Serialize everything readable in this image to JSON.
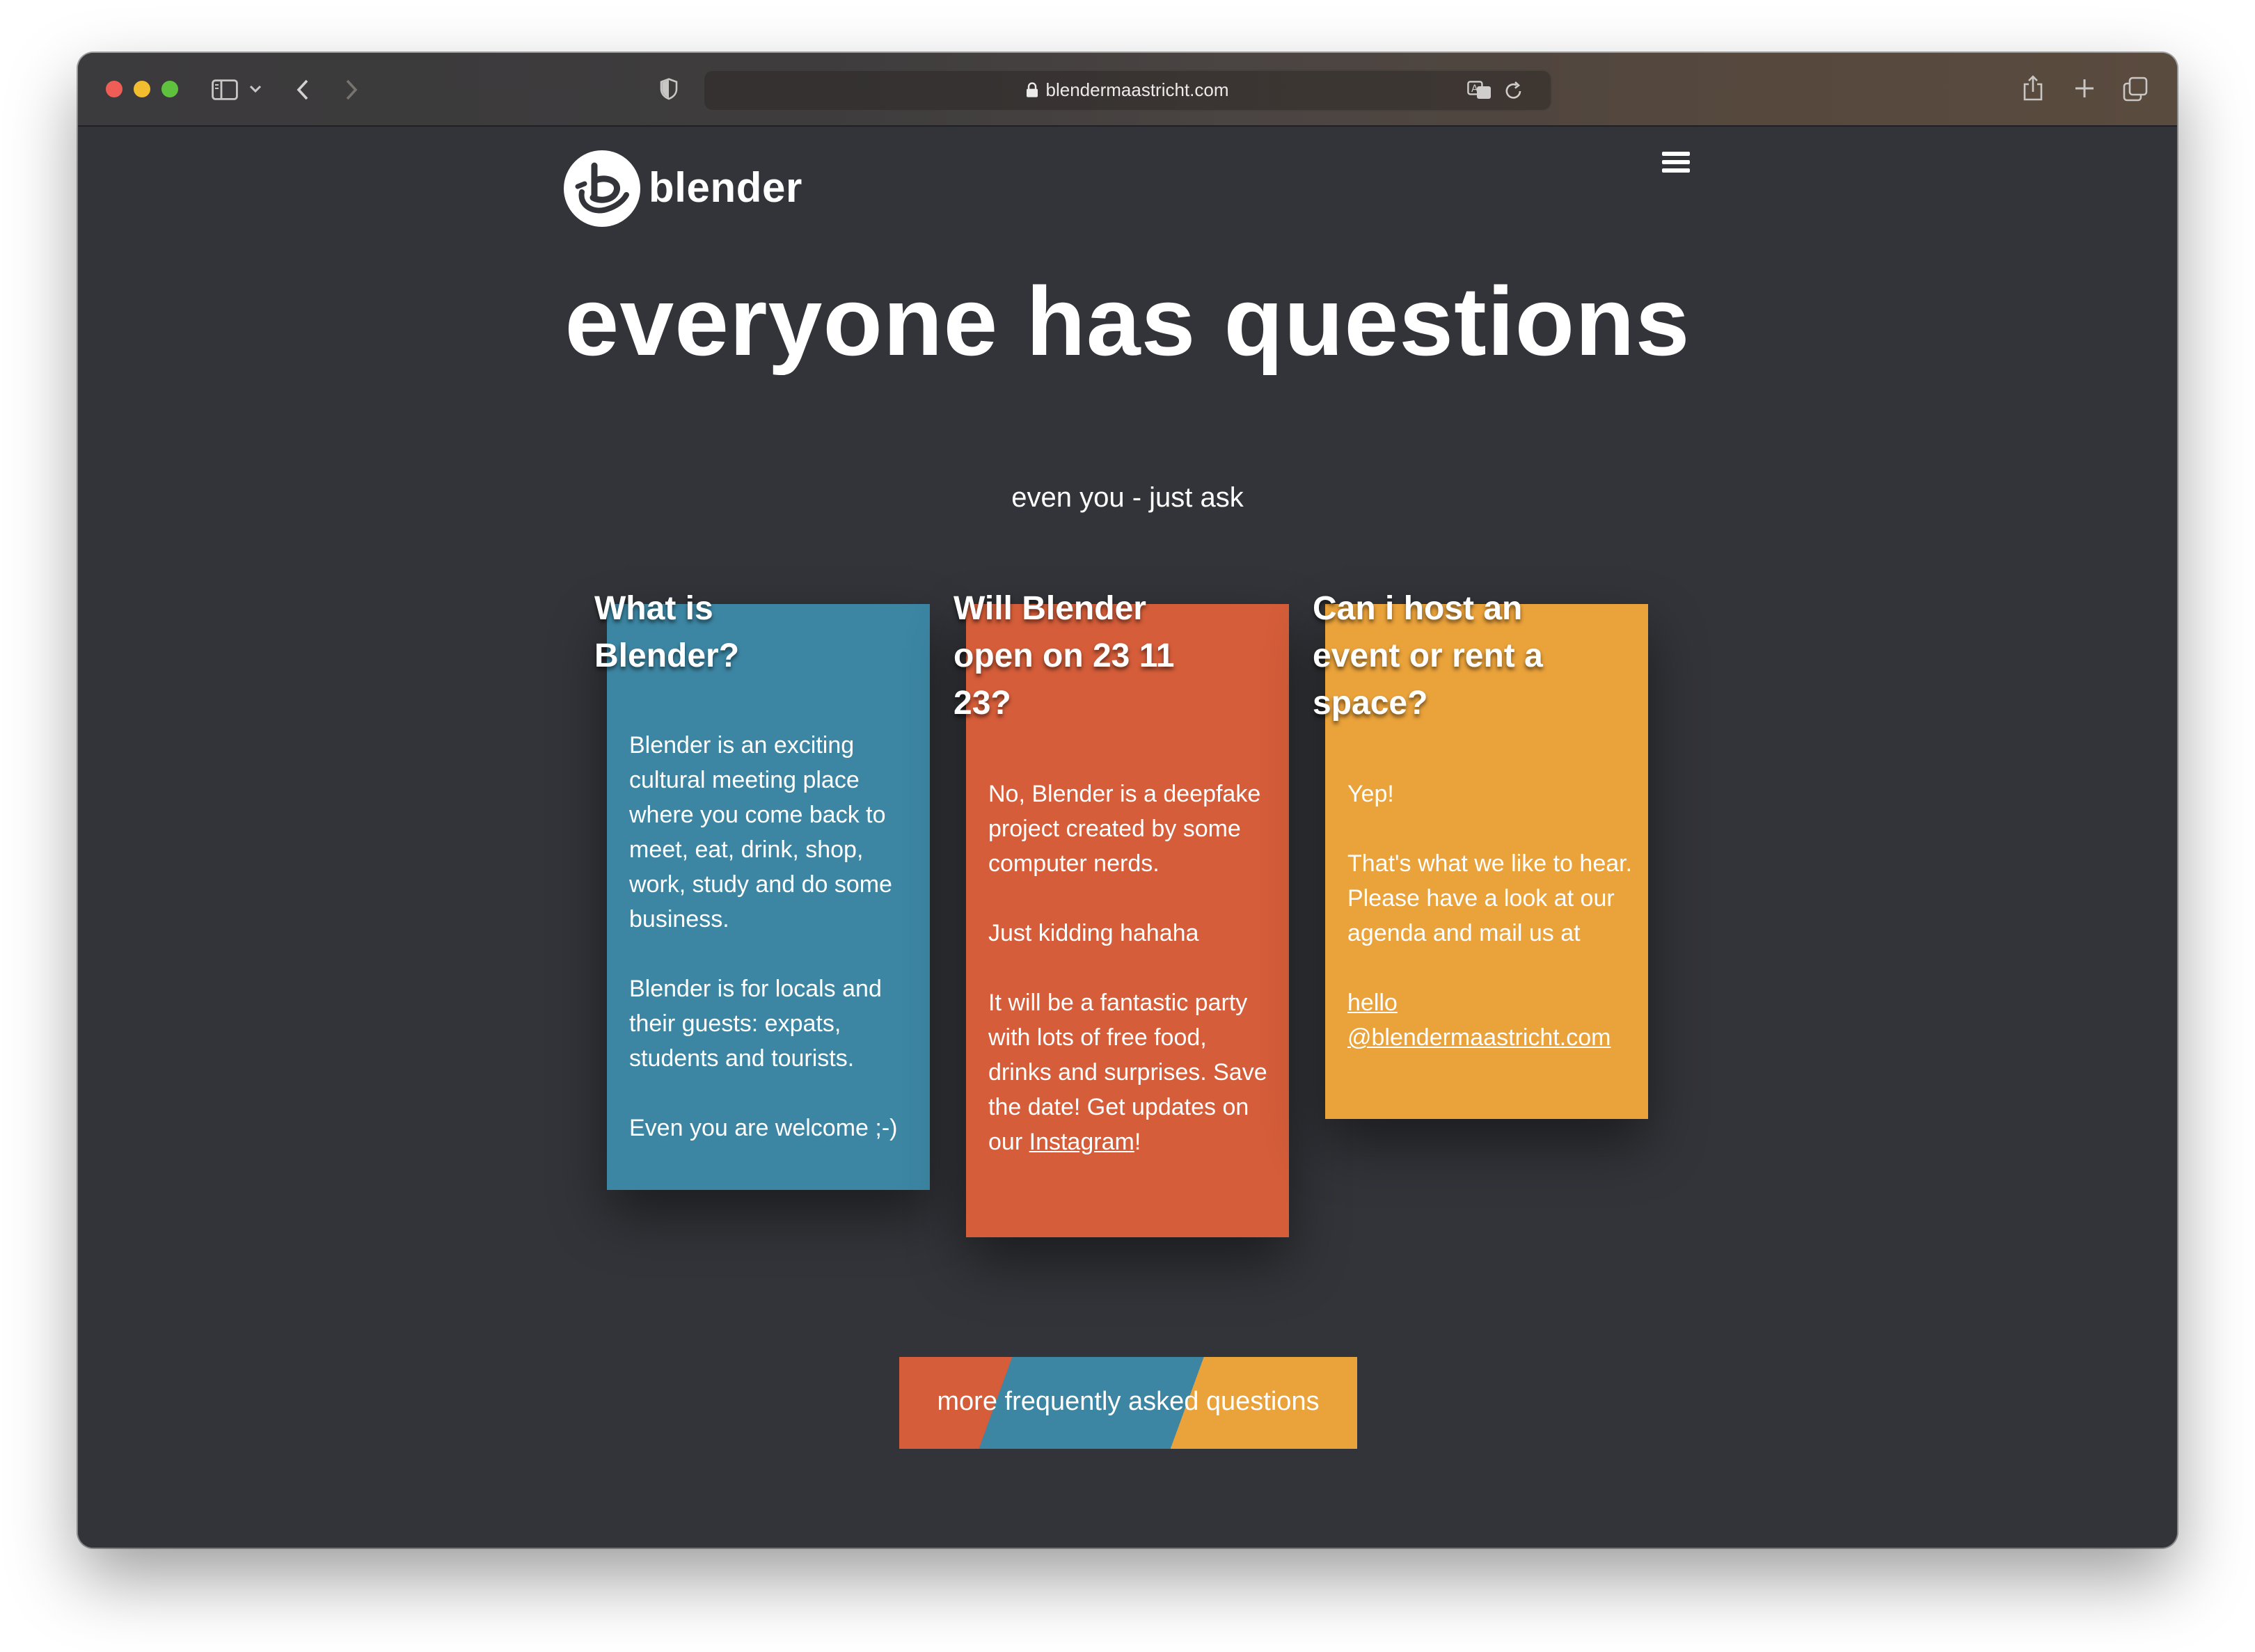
{
  "browser": {
    "url": "blendermaastricht.com",
    "icons": [
      "sidebar-icon",
      "chevron-down-icon",
      "back-icon",
      "forward-icon",
      "shield-icon",
      "lock-icon",
      "translate-icon",
      "reload-icon",
      "share-icon",
      "new-tab-icon",
      "tabs-overview-icon"
    ]
  },
  "site": {
    "logo_text": "blender",
    "menu_icon": "hamburger-icon",
    "hero": {
      "title": "everyone has questions",
      "subtitle": "even you - just ask"
    },
    "cards": [
      {
        "title_lines": [
          "What is",
          "Blender?"
        ],
        "color": "#3c86a3",
        "paragraphs": [
          "Blender is an exciting cultural meeting place where you come back to meet, eat, drink, shop, work, study and do some business.",
          "Blender is for locals and their guests: expats, students and tourists.",
          "Even you are welcome ;-)"
        ]
      },
      {
        "title_lines": [
          "Will Blender",
          "open on 23 11",
          "23?"
        ],
        "color": "#d55d39",
        "paragraphs": [
          "No, Blender is a deepfake project created by some computer nerds.",
          "Just kidding hahaha",
          "It will be a fantastic party with lots of free food, drinks and surprises. Save the date! Get updates on our"
        ],
        "link_text": "Instagram",
        "link_suffix": "!"
      },
      {
        "title_lines": [
          "Can i host an",
          "event or rent a",
          "space?"
        ],
        "color": "#eaa23a",
        "paragraphs": [
          "Yep!",
          "That's what we like to hear. Please have a look at our agenda and mail us at"
        ],
        "email": "hello @blendermaastricht.com"
      }
    ],
    "cta_label": "more frequently asked questions",
    "background_color": "#333439"
  }
}
